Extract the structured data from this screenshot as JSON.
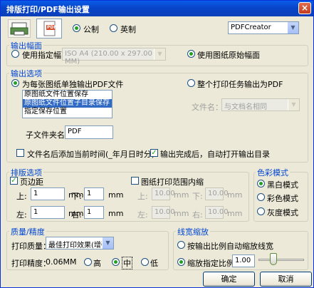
{
  "title": "排版打印/PDF输出设置",
  "close_glyph": "×",
  "toolbar": {
    "unit_metric": "公制",
    "unit_imperial": "英制",
    "printer": "PDFCreator",
    "pdf_icon_text": "PDF"
  },
  "output_size": {
    "title": "输出幅面",
    "use_specified": "使用指定幅面",
    "paper": "ISO A4 (210.00 x 297.00 MM)",
    "use_original": "使用图纸原始幅面"
  },
  "output_options": {
    "title": "输出选项",
    "per_sheet": "为每张图纸单独输出PDF文件",
    "whole_job": "整个打印任务输出为PDF",
    "locations": [
      "原图纸文件位置保存",
      "原图纸文件位置子目录保存",
      "指定保存位置"
    ],
    "selected_location_index": 1,
    "filename_label": "文件名：",
    "filename_value": "与文档名相同",
    "subfolder_label": "子文件夹名:",
    "subfolder_value": "PDF",
    "append_time": "文件名后添加当前时间(_年月日时分)",
    "open_dir": "输出完成后，自动打开输出目录"
  },
  "layout": {
    "title": "排版选项",
    "margin": "页边距",
    "top": "上:",
    "bottom": "下:",
    "left": "左:",
    "right": "右:",
    "unit": "mm",
    "top_val": "1",
    "bottom_val": "1",
    "left_val": "1",
    "right_val": "1",
    "inner": "图纸打印范围内缩",
    "in_top": "上:",
    "in_bottom": "下:",
    "in_left": "左:",
    "in_right": "右:",
    "in_val": "10.00"
  },
  "color": {
    "title": "色彩模式",
    "bw": "黑白模式",
    "color": "彩色模式",
    "gray": "灰度模式"
  },
  "quality": {
    "title": "质量/精度",
    "print_quality_label": "打印质量：",
    "print_quality_value": "最佳打印效果(增强)",
    "precision_label": "打印精度：",
    "precision_value": "0.06MM",
    "high": "高",
    "mid": "中",
    "low": "低"
  },
  "linewidth": {
    "title": "线宽缩放",
    "auto": "按输出比例自动缩放线宽",
    "specified": "缩放指定比例",
    "scale_value": "1.00",
    "slider_position_pct": 30
  },
  "buttons": {
    "ok": "确定",
    "cancel": "取消"
  }
}
